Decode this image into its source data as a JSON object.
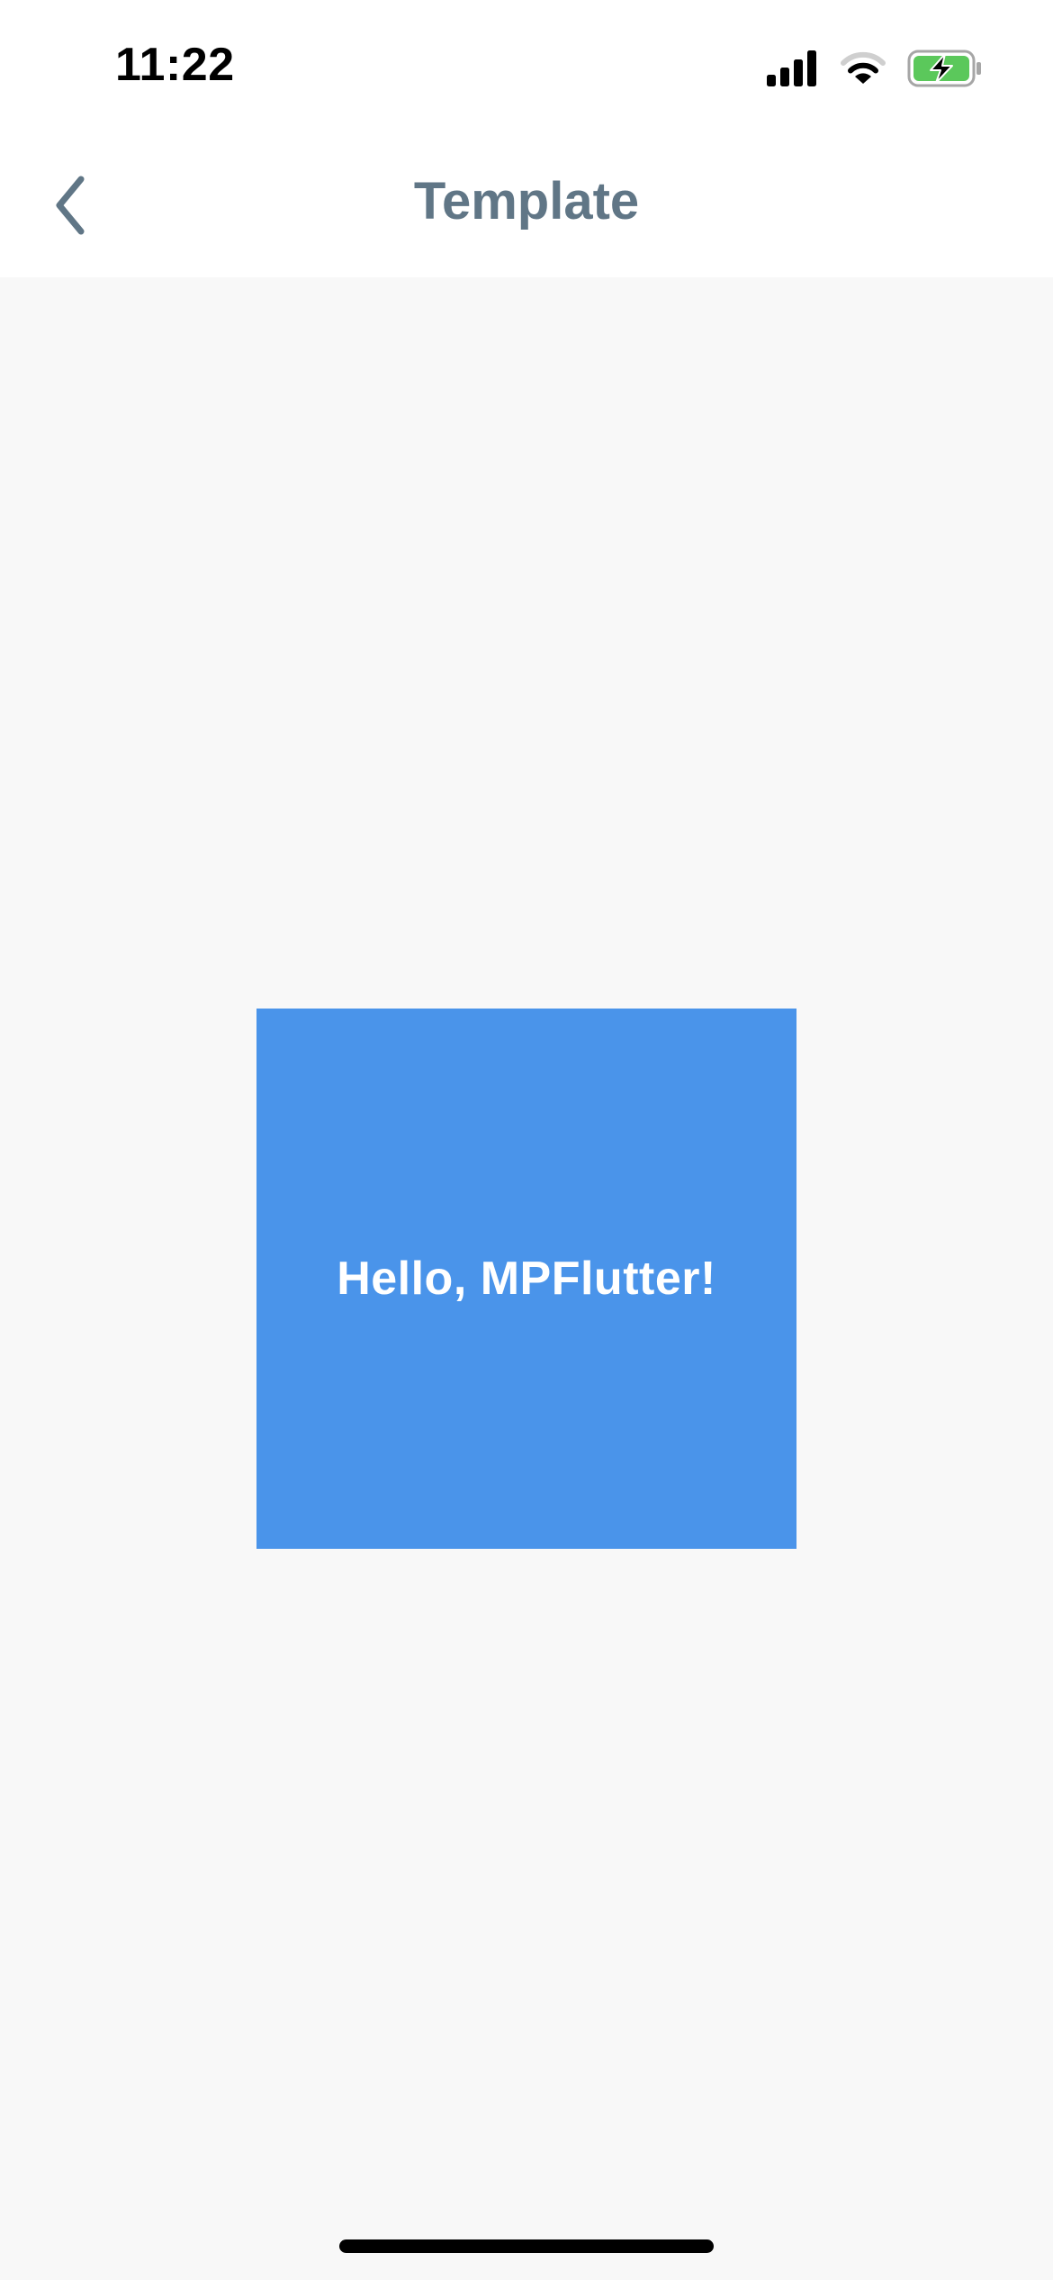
{
  "status_bar": {
    "time": "11:22",
    "icons": [
      "cellular-signal-icon",
      "wifi-icon",
      "battery-charging-icon"
    ],
    "battery_color": "#5bc85b"
  },
  "nav_bar": {
    "title": "Template",
    "back_icon": "chevron-left-icon",
    "title_color": "#607686"
  },
  "content": {
    "box_text": "Hello, MPFlutter!",
    "box_color": "#4a94ea",
    "background_color": "#f8f8f8"
  }
}
